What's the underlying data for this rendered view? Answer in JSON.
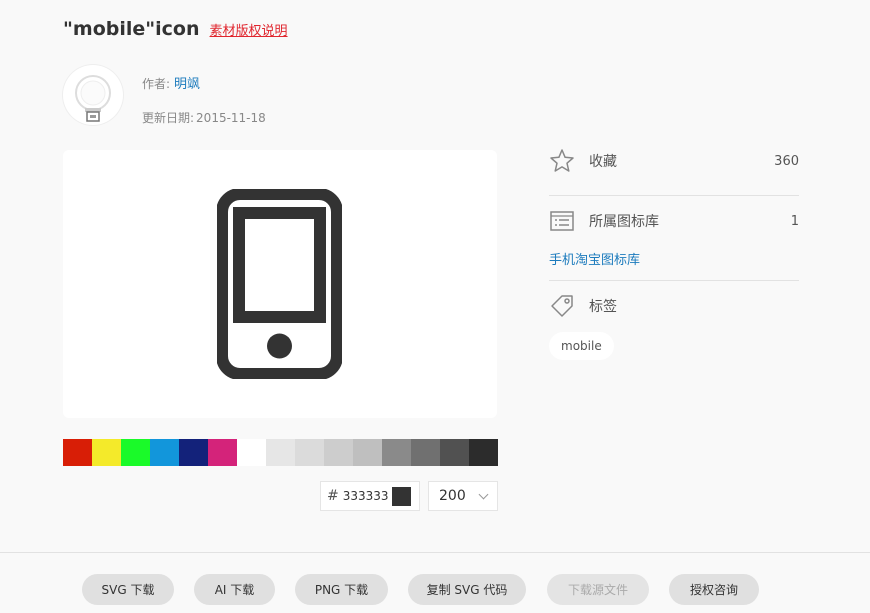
{
  "header": {
    "title": "\"mobile\"icon",
    "copyright_link": "素材版权说明"
  },
  "author": {
    "label": "作者:",
    "name": "明飒",
    "date_label": "更新日期:",
    "date": "2015-11-18"
  },
  "preview": {
    "icon": "mobile-phone-icon",
    "color": "#333333"
  },
  "palette": [
    "#d81e06",
    "#f4ea2a",
    "#1afa29",
    "#1296db",
    "#13227a",
    "#d4237a",
    "#ffffff",
    "#e6e6e6",
    "#dbdbdb",
    "#cdcdcd",
    "#bfbfbf",
    "#8a8a8a",
    "#707070",
    "#515151",
    "#2c2c2c"
  ],
  "color_input": {
    "hash": "#",
    "value": "333333"
  },
  "size_select": {
    "value": "200"
  },
  "sidebar": {
    "favorite_label": "收藏",
    "favorite_count": "360",
    "library_label": "所属图标库",
    "library_count": "1",
    "library_link": "手机淘宝图标库",
    "tags_label": "标签",
    "tag": "mobile"
  },
  "footer": {
    "svg_download": "SVG 下载",
    "ai_download": "AI 下载",
    "png_download": "PNG 下载",
    "copy_svg": "复制 SVG 代码",
    "source_download": "下载源文件",
    "license": "授权咨询"
  }
}
